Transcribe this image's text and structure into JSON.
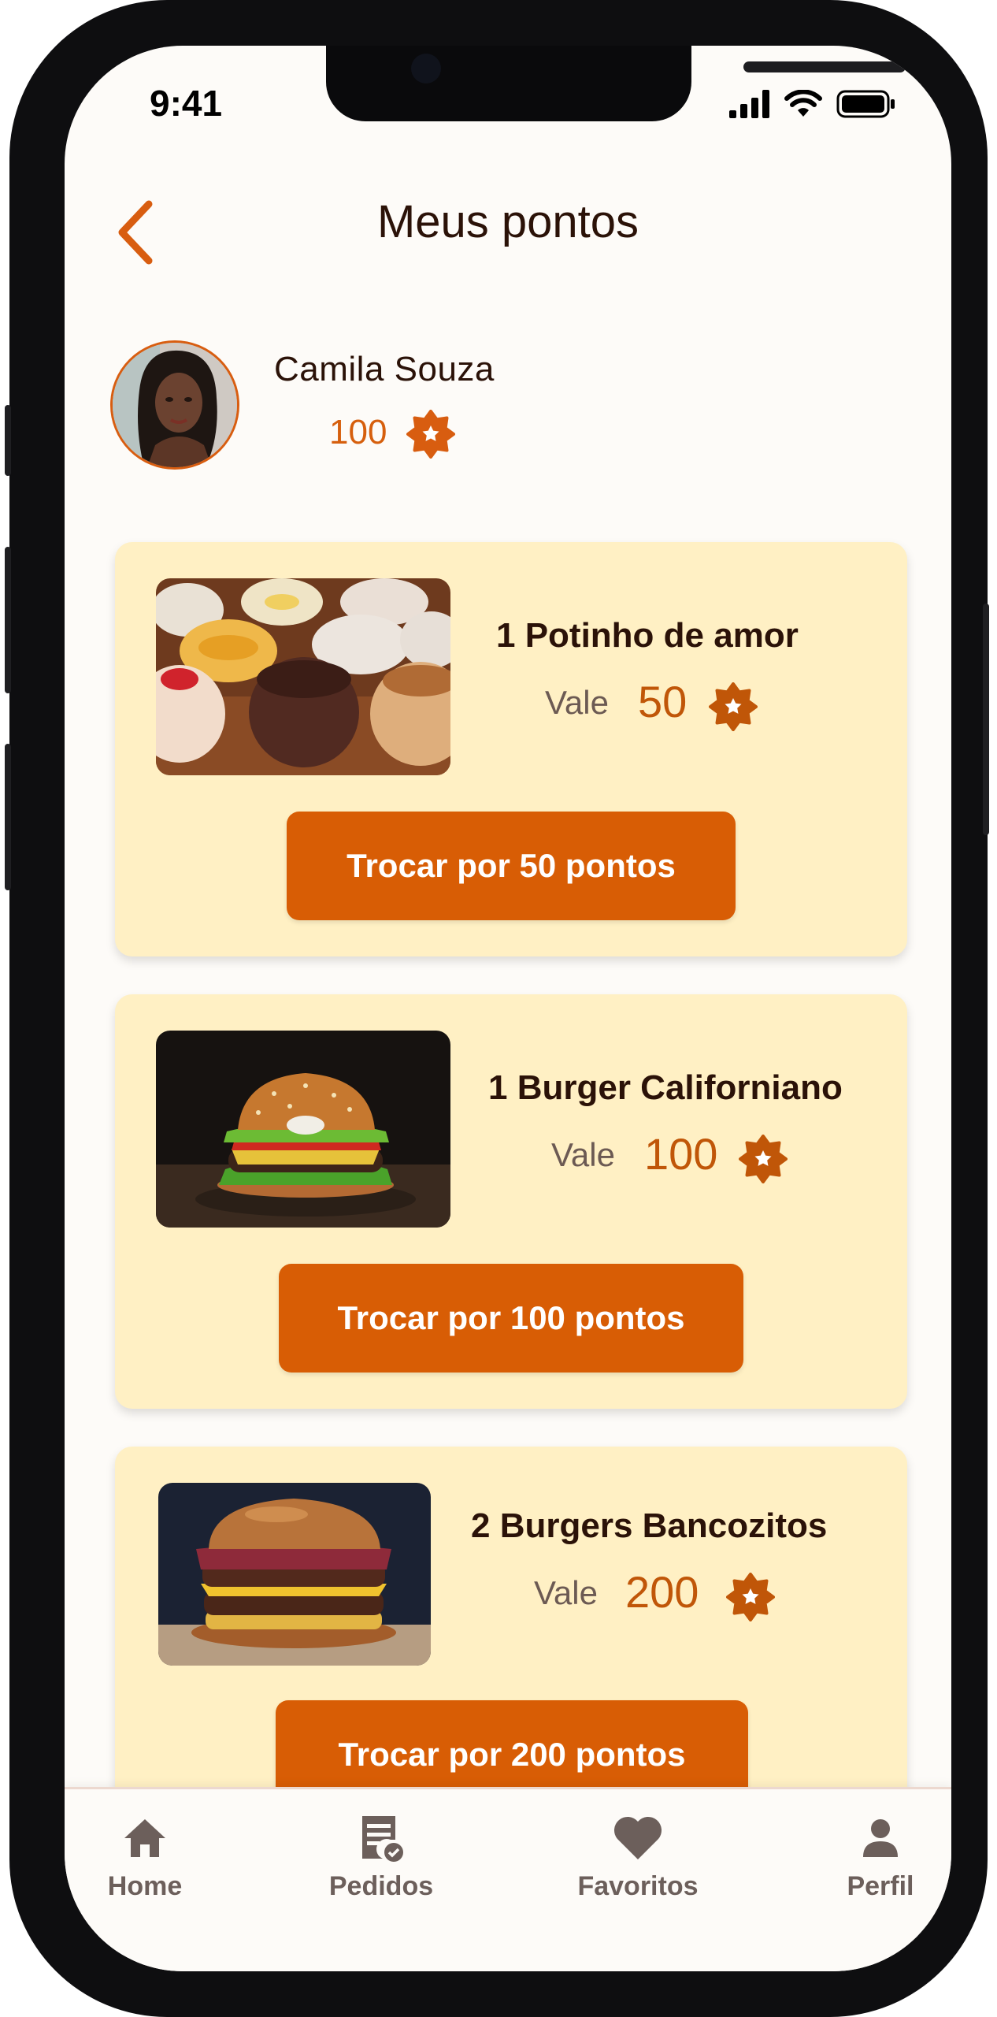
{
  "status_bar": {
    "time": "9:41"
  },
  "header": {
    "title": "Meus pontos"
  },
  "profile": {
    "name": "Camila Souza",
    "points": "100"
  },
  "rewards": [
    {
      "title": "1 Potinho de amor",
      "vale_label": "Vale",
      "value": "50",
      "button_label": "Trocar por 50 pontos"
    },
    {
      "title": "1 Burger Californiano",
      "vale_label": "Vale",
      "value": "100",
      "button_label": "Trocar por 100 pontos"
    },
    {
      "title": "2 Burgers Bancozitos",
      "vale_label": "Vale",
      "value": "200",
      "button_label": "Trocar por 200 pontos"
    }
  ],
  "tab_bar": {
    "items": [
      {
        "label": "Home",
        "icon": "home-icon"
      },
      {
        "label": "Pedidos",
        "icon": "receipt-icon"
      },
      {
        "label": "Favoritos",
        "icon": "heart-icon"
      },
      {
        "label": "Perfil",
        "icon": "person-icon"
      }
    ]
  },
  "colors": {
    "accent": "#d85d05",
    "card_background": "#fff0c4",
    "title_text": "#2b1208",
    "points_text": "#c05608"
  }
}
